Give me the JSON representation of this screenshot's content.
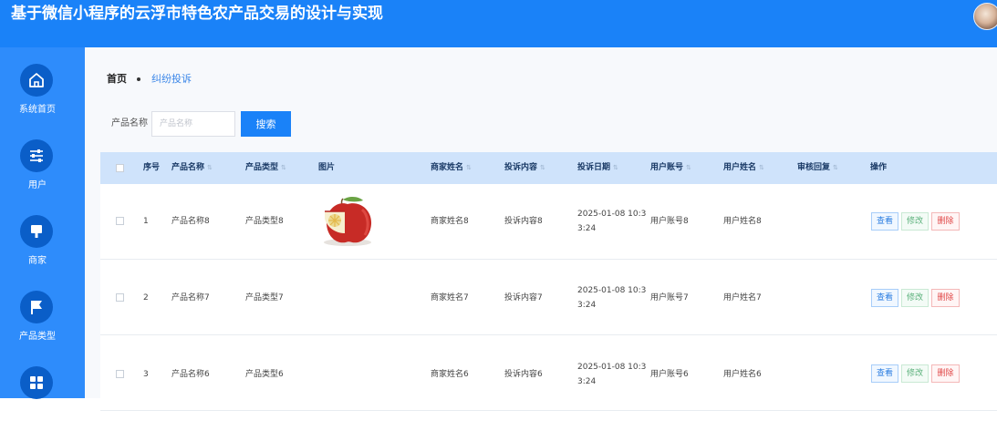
{
  "app": {
    "title": "基于微信小程序的云浮市特色农产品交易的设计与实现"
  },
  "sidebar": {
    "items": [
      {
        "label": "系统首页",
        "icon": "home-icon"
      },
      {
        "label": "用户",
        "icon": "sliders-icon"
      },
      {
        "label": "商家",
        "icon": "paint-brush-icon"
      },
      {
        "label": "产品类型",
        "icon": "flag-icon"
      },
      {
        "label": "",
        "icon": "grid-icon"
      }
    ]
  },
  "breadcrumb": {
    "home": "首页",
    "current": "纠纷投诉"
  },
  "search": {
    "label": "产品名称",
    "placeholder": "产品名称",
    "button": "搜索"
  },
  "table": {
    "headers": {
      "index": "序号",
      "product_name": "产品名称",
      "product_type": "产品类型",
      "image": "图片",
      "merchant_name": "商家姓名",
      "complaint": "投诉内容",
      "complaint_date": "投诉日期",
      "user_account": "用户账号",
      "user_name": "用户姓名",
      "review_reply": "审核回复",
      "actions": "操作"
    },
    "rows": [
      {
        "index": "1",
        "product_name": "产品名称8",
        "product_type": "产品类型8",
        "has_image": true,
        "merchant_name": "商家姓名8",
        "complaint": "投诉内容8",
        "complaint_date": "2025-01-08 10:33:24",
        "user_account": "用户账号8",
        "user_name": "用户姓名8",
        "review_reply": ""
      },
      {
        "index": "2",
        "product_name": "产品名称7",
        "product_type": "产品类型7",
        "has_image": false,
        "merchant_name": "商家姓名7",
        "complaint": "投诉内容7",
        "complaint_date": "2025-01-08 10:33:24",
        "user_account": "用户账号7",
        "user_name": "用户姓名7",
        "review_reply": ""
      },
      {
        "index": "3",
        "product_name": "产品名称6",
        "product_type": "产品类型6",
        "has_image": false,
        "merchant_name": "商家姓名6",
        "complaint": "投诉内容6",
        "complaint_date": "2025-01-08 10:33:24",
        "user_account": "用户账号6",
        "user_name": "用户姓名6",
        "review_reply": ""
      }
    ],
    "actions": {
      "view": "查看",
      "edit": "修改",
      "delete": "删除"
    }
  },
  "colors": {
    "header": "#1a82f8",
    "sidebar": "#2e8cfb",
    "sidebar_icon_circle": "#0a5ec8",
    "table_header": "#cfe3fb",
    "view": "#2b7de0",
    "edit": "#5ab07a",
    "delete": "#e04848"
  }
}
